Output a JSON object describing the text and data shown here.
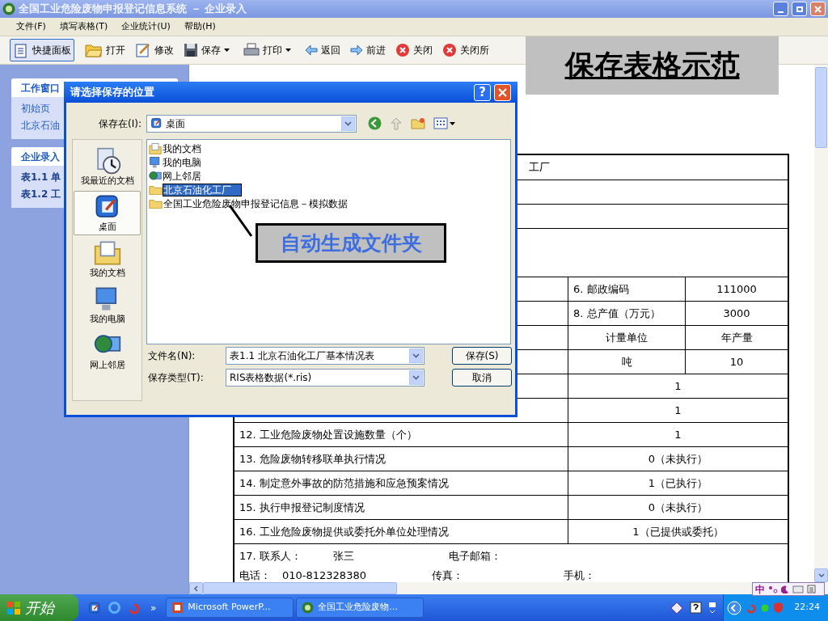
{
  "window": {
    "title": "全国工业危险废物申报登记信息系统 － 企业录入",
    "menu": [
      "文件(F)",
      "填写表格(T)",
      "企业统计(U)",
      "帮助(H)"
    ],
    "toolbar": [
      {
        "label": "快捷面板",
        "selected": true,
        "dropdown": false
      },
      {
        "label": "打开",
        "selected": false,
        "dropdown": false
      },
      {
        "label": "修改",
        "selected": false,
        "dropdown": false
      },
      {
        "label": "保存",
        "selected": false,
        "dropdown": true
      },
      {
        "label": "打印",
        "selected": false,
        "dropdown": true
      },
      {
        "label": "返回",
        "selected": false,
        "dropdown": false
      },
      {
        "label": "前进",
        "selected": false,
        "dropdown": false
      },
      {
        "label": "关闭",
        "selected": false,
        "dropdown": false
      },
      {
        "label": "关闭所",
        "selected": false,
        "dropdown": false
      }
    ]
  },
  "sidebar": {
    "panels": [
      {
        "title": "工作窗口",
        "items": [
          "初始页",
          "北京石油"
        ]
      },
      {
        "title": "企业录入",
        "items": [
          "表1.1 单",
          "表1.2 工"
        ]
      }
    ]
  },
  "form_table": {
    "rows": [
      {
        "kind": "name",
        "text": "工厂"
      },
      {
        "kind": "blank"
      },
      {
        "kind": "blank"
      },
      {
        "kind": "tall"
      },
      {
        "kind": "detail",
        "label": "6. 邮政编码",
        "value": "111000"
      },
      {
        "kind": "detail",
        "label": "8. 总产值（万元）",
        "value": "3000"
      },
      {
        "kind": "unit",
        "label": "计量单位",
        "value": "年产量"
      },
      {
        "kind": "unit",
        "label": "吨",
        "value": "10"
      },
      {
        "kind": "value",
        "value": "1"
      },
      {
        "kind": "value",
        "value": "1"
      },
      {
        "kind": "item",
        "label": "12.  工业危险废物处置设施数量（个）",
        "value": "1"
      },
      {
        "kind": "item",
        "label": "13.  危险废物转移联单执行情况",
        "value": "0（未执行）"
      },
      {
        "kind": "item",
        "label": "14.  制定意外事故的防范措施和应急预案情况",
        "value": "1（已执行）"
      },
      {
        "kind": "item",
        "label": "15.  执行申报登记制度情况",
        "value": "0（未执行）"
      },
      {
        "kind": "item",
        "label": "16.  工业危险废物提供或委托外单位处理情况",
        "value": "1（已提供或委托）"
      },
      {
        "kind": "contact",
        "fields": [
          {
            "label": "17.  联系人：",
            "value": "张三"
          },
          {
            "label": "电子邮箱："
          }
        ]
      },
      {
        "kind": "phone",
        "fields": [
          {
            "label": "电话：",
            "value": "010-812328380"
          },
          {
            "label": "传真："
          },
          {
            "label": "手机："
          }
        ]
      }
    ]
  },
  "dialog": {
    "title": "请选择保存的位置",
    "help": "?",
    "save_in_label": "保存在(I):",
    "save_in": "桌面",
    "places": [
      {
        "label": "我最近的文档",
        "selected": false
      },
      {
        "label": "桌面",
        "selected": true
      },
      {
        "label": "我的文档",
        "selected": false
      },
      {
        "label": "我的电脑",
        "selected": false
      },
      {
        "label": "网上邻居",
        "selected": false
      }
    ],
    "files": [
      {
        "name": "我的文档",
        "kind": "docs",
        "selected": false
      },
      {
        "name": "我的电脑",
        "kind": "computer",
        "selected": false
      },
      {
        "name": "网上邻居",
        "kind": "network",
        "selected": false
      },
      {
        "name": "北京石油化工厂",
        "kind": "folder",
        "selected": true
      },
      {
        "name": "全国工业危险废物申报登记信息－模拟数据",
        "kind": "folder",
        "selected": false
      }
    ],
    "filename_label": "文件名(N):",
    "filename": "表1.1 北京石油化工厂基本情况表",
    "filetype_label": "保存类型(T):",
    "filetype": "RIS表格数据(*.ris)",
    "buttons": [
      "保存(S)",
      "取消"
    ]
  },
  "callouts": [
    "保存表格示范",
    "自动生成文件夹"
  ],
  "ime": "中",
  "taskbar": {
    "start": "开始",
    "more": "»",
    "tasks": [
      "Microsoft PowerP...",
      "全国工业危险废物..."
    ],
    "time": "22:24"
  }
}
